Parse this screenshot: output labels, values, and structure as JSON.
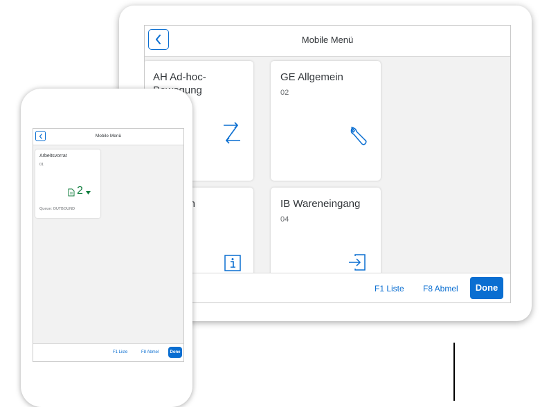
{
  "tablet": {
    "title": "Mobile Menü",
    "tiles": [
      {
        "title": "AH Ad-hoc-Bewegung",
        "icon": "transfer-arrows-icon"
      },
      {
        "title": "GE Allgemein",
        "subtitle": "02",
        "icon": "wrench-icon"
      },
      {
        "title": "gen",
        "icon": "info-icon"
      },
      {
        "title": "IB Wareneingang",
        "subtitle": "04",
        "icon": "inbound-arrow-icon"
      }
    ],
    "footer": {
      "f1": "F1 Liste",
      "f8": "F8 Abmel",
      "done": "Done"
    }
  },
  "phone": {
    "title": "Mobile Menü",
    "tile": {
      "title": "Arbeitsvorrat",
      "subtitle": "01",
      "count": "2",
      "queue": "Queue: OUTBOUND",
      "icon": "document-icon"
    },
    "footer": {
      "f1": "F1 Liste",
      "f8": "F8 Abmel",
      "done": "Done"
    }
  },
  "colors": {
    "accent": "#0a6ed1",
    "positive": "#107e3e",
    "background": "#f2f2f2"
  }
}
